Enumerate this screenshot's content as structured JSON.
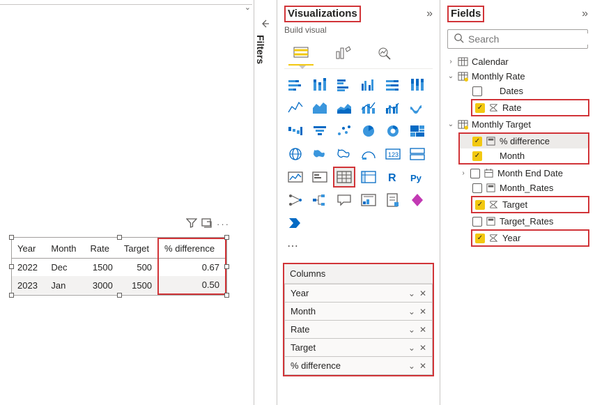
{
  "canvas": {
    "table": {
      "headers": [
        "Year",
        "Month",
        "Rate",
        "Target",
        "% difference"
      ],
      "rows": [
        {
          "year": "2022",
          "month": "Dec",
          "rate": "1500",
          "target": "500",
          "diff": "0.67"
        },
        {
          "year": "2023",
          "month": "Jan",
          "rate": "3000",
          "target": "1500",
          "diff": "0.50"
        }
      ]
    }
  },
  "filters": {
    "label": "Filters"
  },
  "viz": {
    "title": "Visualizations",
    "subtitle": "Build visual",
    "columns": {
      "title": "Columns",
      "items": [
        "Year",
        "Month",
        "Rate",
        "Target",
        "% difference"
      ]
    }
  },
  "fields": {
    "title": "Fields",
    "search_placeholder": "Search",
    "tree": {
      "calendar": "Calendar",
      "monthly_rate": "Monthly Rate",
      "monthly_rate_items": {
        "dates": "Dates",
        "rate": "Rate"
      },
      "monthly_target": "Monthly Target",
      "monthly_target_items": {
        "pct_difference": "% difference",
        "month": "Month",
        "month_end_date": "Month End Date",
        "month_rates": "Month_Rates",
        "target": "Target",
        "target_rates": "Target_Rates",
        "year": "Year"
      }
    }
  }
}
